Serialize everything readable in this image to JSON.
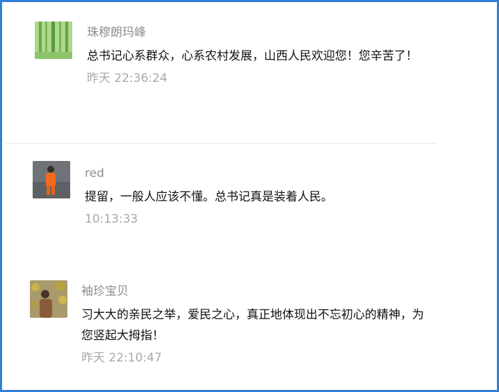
{
  "comments": [
    {
      "author": "珠穆朗玛峰",
      "avatar_icon": "bamboo-forest-avatar",
      "text": "总书记心系群众，心系农村发展，山西人民欢迎您！您辛苦了！",
      "time": "昨天 22:36:24"
    },
    {
      "author": "red",
      "avatar_icon": "person-orange-coat-avatar",
      "text": "提留，一般人应该不懂。总书记真是装着人民。",
      "time": "10:13:33"
    },
    {
      "author": "袖珍宝贝",
      "avatar_icon": "woman-flowers-avatar",
      "text": "习大大的亲民之举，爱民之心，真正地体现出不忘初心的精神，为您竖起大拇指！",
      "time": "昨天 22:10:47"
    }
  ]
}
